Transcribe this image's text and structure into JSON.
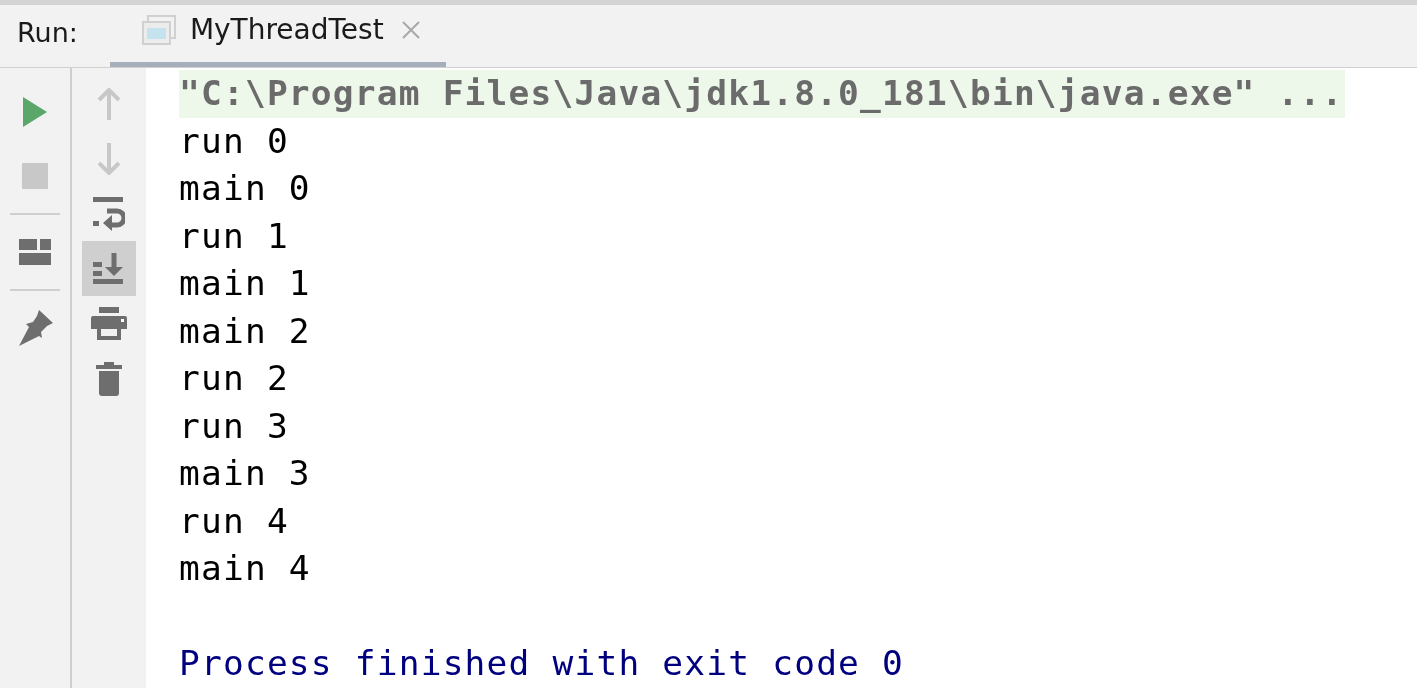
{
  "header": {
    "label": "Run:"
  },
  "tabs": [
    {
      "title": "MyThreadTest",
      "selected": true,
      "closable": true
    }
  ],
  "left_toolbar": [
    {
      "kind": "run",
      "disabled": false
    },
    {
      "kind": "stop",
      "disabled": true
    },
    {
      "kind": "separator"
    },
    {
      "kind": "layout",
      "disabled": false
    },
    {
      "kind": "separator"
    },
    {
      "kind": "pin",
      "disabled": false
    }
  ],
  "right_toolbar": [
    {
      "kind": "up",
      "disabled": true,
      "selected": false
    },
    {
      "kind": "down",
      "disabled": true,
      "selected": false
    },
    {
      "kind": "wrap",
      "disabled": false,
      "selected": false
    },
    {
      "kind": "scroll-end",
      "disabled": false,
      "selected": true
    },
    {
      "kind": "print",
      "disabled": false,
      "selected": false
    },
    {
      "kind": "trash",
      "disabled": false,
      "selected": false
    }
  ],
  "console": [
    {
      "kind": "command",
      "text": "\"C:\\Program Files\\Java\\jdk1.8.0_181\\bin\\java.exe\" ..."
    },
    {
      "kind": "stdout",
      "text": "run 0"
    },
    {
      "kind": "stdout",
      "text": "main 0"
    },
    {
      "kind": "stdout",
      "text": "run 1"
    },
    {
      "kind": "stdout",
      "text": "main 1"
    },
    {
      "kind": "stdout",
      "text": "main 2"
    },
    {
      "kind": "stdout",
      "text": "run 2"
    },
    {
      "kind": "stdout",
      "text": "run 3"
    },
    {
      "kind": "stdout",
      "text": "main 3"
    },
    {
      "kind": "stdout",
      "text": "run 4"
    },
    {
      "kind": "stdout",
      "text": "main 4"
    },
    {
      "kind": "blank"
    },
    {
      "kind": "system",
      "text": "Process finished with exit code 0"
    }
  ]
}
